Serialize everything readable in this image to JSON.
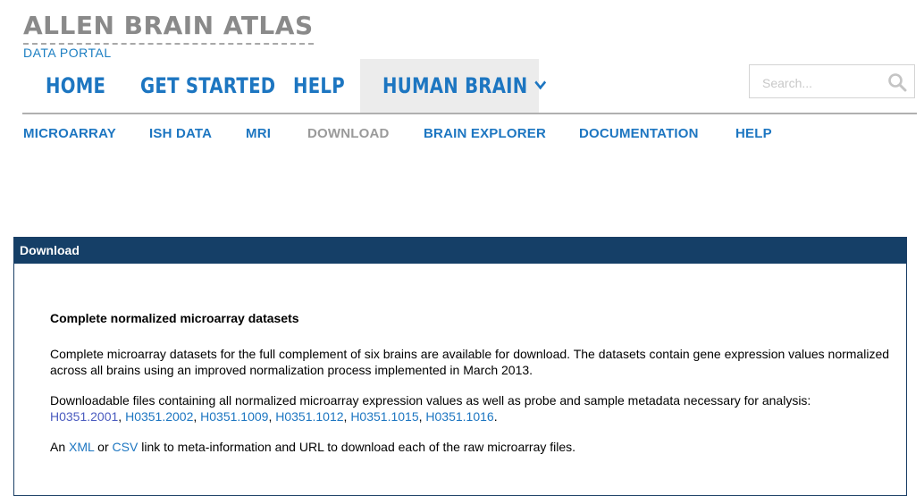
{
  "logo": {
    "title": "ALLEN BRAIN ATLAS",
    "subtitle": "DATA PORTAL"
  },
  "topnav": {
    "items": [
      {
        "label": "HOME"
      },
      {
        "label": "GET STARTED"
      },
      {
        "label": "HELP"
      },
      {
        "label": "HUMAN BRAIN",
        "active": true
      }
    ]
  },
  "search": {
    "placeholder": "Search..."
  },
  "subnav": {
    "items": [
      {
        "label": "MICROARRAY"
      },
      {
        "label": "ISH DATA"
      },
      {
        "label": "MRI"
      },
      {
        "label": "DOWNLOAD",
        "active": true
      },
      {
        "label": "BRAIN EXPLORER"
      },
      {
        "label": "DOCUMENTATION"
      },
      {
        "label": "HELP"
      }
    ]
  },
  "panel": {
    "title": "Download",
    "heading": "Complete normalized microarray datasets",
    "para1": "Complete microarray datasets for the full complement of six brains are available for download. The datasets contain gene expression values normalized across all brains using an improved normalization process implemented in March 2013.",
    "para2": "Downloadable files containing all normalized microarray expression values as well as probe and sample metadata necessary for analysis:",
    "files": [
      "H0351.2001",
      "H0351.2002",
      "H0351.1009",
      "H0351.1012",
      "H0351.1015",
      "H0351.1016"
    ],
    "files_sep": ", ",
    "files_end": ".",
    "para3_prefix": "An ",
    "para3_link1": "XML",
    "para3_mid": " or ",
    "para3_link2": "CSV",
    "para3_suffix": " link to meta-information and URL to download each of the raw microarray files."
  },
  "colors": {
    "accent": "#1d76c1",
    "panel_header": "#153f67",
    "inactive": "#9a9a9a"
  }
}
